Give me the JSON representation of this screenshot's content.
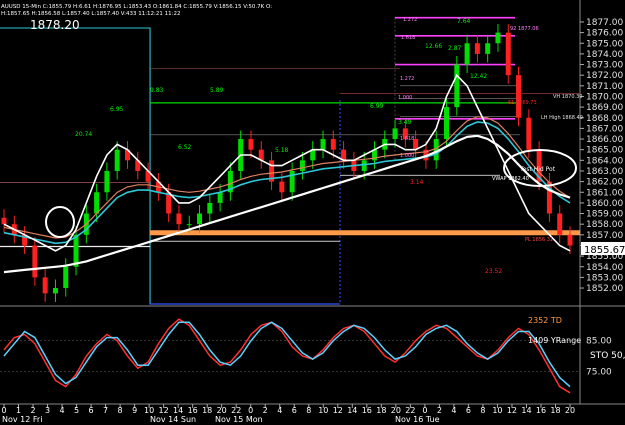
{
  "header": {
    "symbol": "AUUSD 15-Min",
    "quote": "C:1855.79  H:6.61  H:1876.95  L:1853.43  O:1861.84  C:1855.79  V:1856.15  V:50.7K  O:",
    "quote2": "H:1857.65  H:1856.58  L:1857.40  L:1857.40  V:433  11:12:21  11:22",
    "big_level": "1878.20"
  },
  "colors": {
    "bg": "#000000",
    "up": "#00dd00",
    "down": "#ff2020",
    "white_ma": "#ffffff",
    "cyan_ma": "#2ec7d6",
    "salmon_ma": "#e08060",
    "orange_band": "#ff9a4a",
    "magenta": "#ff40ff",
    "stoch_red": "#ff3030",
    "stoch_cyan": "#5ad2ff",
    "info_orange": "#ff9a4a"
  },
  "chart_data": {
    "type": "line",
    "title": "AUUSD 15-Min",
    "ylim": [
      1850.5,
      1878.5
    ],
    "yticks": [
      1852.0,
      1853.0,
      1854.0,
      1855.0,
      1856.0,
      1857.0,
      1858.0,
      1859.0,
      1860.0,
      1861.0,
      1862.0,
      1863.0,
      1864.0,
      1865.0,
      1866.0,
      1867.0,
      1868.0,
      1869.0,
      1870.0,
      1871.0,
      1872.0,
      1873.0,
      1874.0,
      1875.0,
      1876.0,
      1877.0
    ],
    "last_price": "1855.67",
    "price_close_approx": [
      1858,
      1857,
      1856,
      1853,
      1851.5,
      1852,
      1854,
      1857,
      1859,
      1861,
      1863,
      1865,
      1864,
      1863,
      1862,
      1861,
      1859,
      1858,
      1858,
      1859,
      1860,
      1861,
      1863,
      1866,
      1865,
      1864,
      1862,
      1861,
      1863,
      1864,
      1865,
      1866,
      1865,
      1864,
      1863,
      1864,
      1865,
      1866,
      1867,
      1866,
      1865,
      1864,
      1866,
      1869,
      1873,
      1875,
      1874,
      1875,
      1876,
      1872,
      1868,
      1865,
      1862,
      1859,
      1857,
      1856
    ],
    "ma_white": [
      1858,
      1857.5,
      1857,
      1856.5,
      1856,
      1855.5,
      1856,
      1857.5,
      1860,
      1862.5,
      1864.5,
      1865.5,
      1865,
      1864,
      1863,
      1862,
      1861,
      1860,
      1860,
      1860.5,
      1861.5,
      1862.5,
      1863.5,
      1864.5,
      1864.5,
      1864,
      1863.5,
      1863.5,
      1864,
      1864.5,
      1865,
      1865,
      1864.5,
      1864,
      1864,
      1864.5,
      1865,
      1865.5,
      1865.5,
      1865,
      1865,
      1865.5,
      1867,
      1870,
      1872,
      1871,
      1869,
      1867,
      1865,
      1863,
      1861,
      1859,
      1858,
      1857,
      1856,
      1855.5
    ],
    "ma_cyan": [
      1857.2,
      1857,
      1856.8,
      1856.6,
      1856.4,
      1856.2,
      1856.3,
      1856.8,
      1857.5,
      1858.5,
      1859.5,
      1860.5,
      1861,
      1861.2,
      1861.2,
      1861,
      1860.8,
      1860.6,
      1860.5,
      1860.6,
      1860.8,
      1861,
      1861.3,
      1861.7,
      1862,
      1862.2,
      1862.3,
      1862.4,
      1862.6,
      1862.8,
      1863,
      1863.2,
      1863.3,
      1863.4,
      1863.5,
      1863.6,
      1863.7,
      1863.9,
      1864,
      1864.1,
      1864.2,
      1864.3,
      1864.6,
      1865.3,
      1866.3,
      1867.2,
      1867.6,
      1867.5,
      1867,
      1866,
      1864.8,
      1863.5,
      1862.4,
      1861.4,
      1860.6,
      1860
    ],
    "ma_long_white": [
      1853.5,
      1853.6,
      1853.7,
      1853.8,
      1853.9,
      1854,
      1854.1,
      1854.3,
      1854.5,
      1854.8,
      1855.1,
      1855.4,
      1855.7,
      1856,
      1856.3,
      1856.6,
      1856.9,
      1857.2,
      1857.5,
      1857.8,
      1858.1,
      1858.4,
      1858.7,
      1859,
      1859.3,
      1859.6,
      1859.9,
      1860.2,
      1860.5,
      1860.8,
      1861.1,
      1861.4,
      1861.7,
      1862,
      1862.3,
      1862.6,
      1862.9,
      1863.2,
      1863.5,
      1863.8,
      1864.1,
      1864.4,
      1864.8,
      1865.3,
      1865.8,
      1866.2,
      1866.3,
      1866,
      1865.4,
      1864.6,
      1863.6,
      1862.6,
      1861.8,
      1861.2,
      1860.8,
      1860.5
    ],
    "annotations": [
      "20.74",
      "6.95",
      "9.83",
      "5.89",
      "6.52",
      "5.18",
      "6.99",
      "3.49",
      "12.66",
      "7.64",
      "2.87",
      "12.42",
      "3.14",
      "23.52",
      "1.272",
      "1.618",
      "1.000",
      "1.272",
      "1.618",
      "1.000",
      "92 1877.06",
      "61 1869.73",
      "VH 1870.30",
      "LH High 1868.49",
      "VWAP 1862.40",
      "PL 1856.31"
    ],
    "callout": "Test Hid Pot",
    "stoch": {
      "ylim": [
        65,
        95
      ],
      "yticks": [
        "85.00",
        "75.00"
      ],
      "label": "STO 50,",
      "info": [
        "2352 TD",
        "1409 YRange"
      ],
      "red": [
        82,
        86,
        87,
        84,
        78,
        72,
        70,
        74,
        80,
        84,
        87,
        85,
        80,
        76,
        78,
        84,
        89,
        92,
        90,
        85,
        80,
        77,
        78,
        82,
        87,
        90,
        91,
        88,
        83,
        80,
        79,
        82,
        86,
        89,
        90,
        88,
        84,
        80,
        78,
        81,
        85,
        88,
        90,
        89,
        86,
        83,
        80,
        79,
        82,
        86,
        89,
        87,
        82,
        76,
        70,
        68
      ],
      "cyan": [
        80,
        84,
        88,
        86,
        80,
        74,
        71,
        73,
        78,
        83,
        86,
        86,
        82,
        77,
        77,
        82,
        87,
        91,
        91,
        87,
        82,
        78,
        77,
        80,
        85,
        89,
        91,
        89,
        85,
        81,
        79,
        81,
        85,
        88,
        90,
        89,
        86,
        82,
        79,
        80,
        83,
        87,
        89,
        90,
        88,
        84,
        81,
        79,
        81,
        85,
        88,
        88,
        84,
        78,
        73,
        70
      ]
    },
    "xticks": [
      "0",
      "1",
      "2",
      "3",
      "4",
      "5",
      "6",
      "7",
      "8",
      "9",
      "10",
      "12",
      "14",
      "16",
      "18",
      "20",
      "22",
      "0",
      "2",
      "4",
      "6",
      "8",
      "10",
      "12",
      "14",
      "16",
      "18",
      "20",
      "22",
      "0",
      "2",
      "4",
      "6",
      "8",
      "10",
      "12",
      "14",
      "16",
      "18",
      "20"
    ],
    "date_labels": [
      "Nov 12 Fri",
      "Nov 14 Sun",
      "Nov 15 Mon",
      "Nov 16 Tue"
    ]
  }
}
